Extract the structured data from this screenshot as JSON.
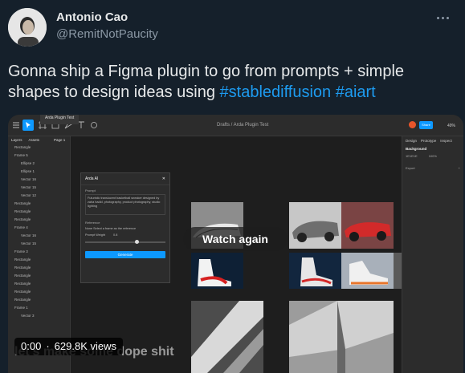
{
  "author": {
    "display_name": "Antonio Cao",
    "handle": "@RemitNotPaucity"
  },
  "tweet": {
    "text_plain": "Gonna ship a Figma plugin to go from prompts + simple shapes to design ideas using ",
    "hashtags": [
      "#stablediffusion",
      "#aiart"
    ]
  },
  "video": {
    "time": "0:00",
    "separator": "·",
    "views": "629.8K views",
    "replay_label": "Watch again",
    "caption": "let's make some dope shit"
  },
  "figma": {
    "tab_title": "Arda Plugin Test",
    "breadcrumb": "Drafts / Arda Plugin Test",
    "share_label": "Share",
    "zoom": "49%",
    "layers_tabs": [
      "Layers",
      "Assets"
    ],
    "page_label": "Page 1",
    "layers": [
      {
        "label": "Rectangle",
        "indent": false
      },
      {
        "label": "Frame 5",
        "indent": false
      },
      {
        "label": "Ellipse 2",
        "indent": true
      },
      {
        "label": "Ellipse 1",
        "indent": true
      },
      {
        "label": "Vector 16",
        "indent": true
      },
      {
        "label": "Vector 15",
        "indent": true
      },
      {
        "label": "Vector 12",
        "indent": true
      },
      {
        "label": "Rectangle",
        "indent": false
      },
      {
        "label": "Rectangle",
        "indent": false
      },
      {
        "label": "Rectangle",
        "indent": false
      },
      {
        "label": "Frame 4",
        "indent": false
      },
      {
        "label": "Vector 16",
        "indent": true
      },
      {
        "label": "Vector 15",
        "indent": true
      },
      {
        "label": "Frame 3",
        "indent": false
      },
      {
        "label": "Rectangle",
        "indent": false
      },
      {
        "label": "Rectangle",
        "indent": false
      },
      {
        "label": "Rectangle",
        "indent": false
      },
      {
        "label": "Rectangle",
        "indent": false
      },
      {
        "label": "Rectangle",
        "indent": false
      },
      {
        "label": "Rectangle",
        "indent": false
      },
      {
        "label": "Frame 1",
        "indent": false
      },
      {
        "label": "Vector 3",
        "indent": true
      }
    ],
    "right_tabs": [
      "Design",
      "Prototype",
      "Inspect"
    ],
    "background_label": "Background",
    "background_hex": "1E1E1E",
    "background_opacity": "100%",
    "export_label": "Export",
    "plugin": {
      "title": "Arda AI",
      "prompt_label": "Prompt",
      "prompt_text": "Futuristic translucent basketball sneaker designed by zaha hadid, photography, product photography, studio lighting",
      "reference_label": "Reference",
      "reference_note": "None  Select a frame as the reference",
      "weight_label": "Prompt Weight",
      "weight_value": "0.8",
      "weight_level": 0.62,
      "generate_label": "Generate"
    }
  },
  "colors": {
    "background": "#15202b",
    "text": "#e7e9ea",
    "muted": "#8b98a5",
    "link": "#1d9bf0",
    "figma_accent": "#0d99ff"
  }
}
